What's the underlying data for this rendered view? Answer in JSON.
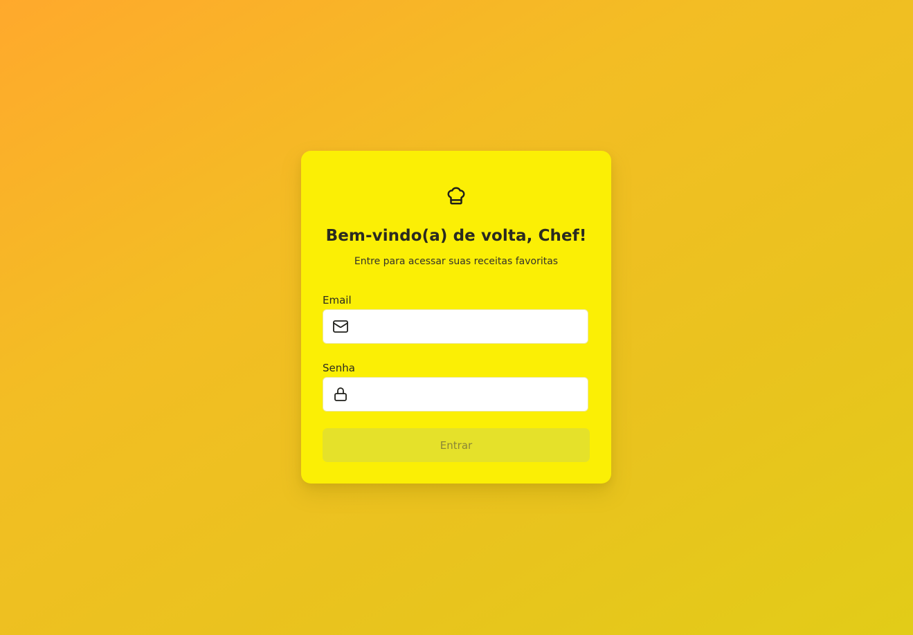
{
  "card": {
    "title": "Bem-vindo(a) de volta, Chef!",
    "subtitle": "Entre para acessar suas receitas favoritas",
    "logo_icon": "chef-hat-icon"
  },
  "form": {
    "email": {
      "label": "Email",
      "value": "",
      "placeholder": "",
      "icon": "mail-icon"
    },
    "password": {
      "label": "Senha",
      "value": "",
      "placeholder": "",
      "icon": "lock-icon"
    },
    "submit_label": "Entrar",
    "submit_disabled": true
  },
  "colors": {
    "background_start": "#ffa92c",
    "background_end": "#e2cc18",
    "card": "#fbef05",
    "button_disabled": "#e5e12a",
    "text": "#2a2a20"
  }
}
